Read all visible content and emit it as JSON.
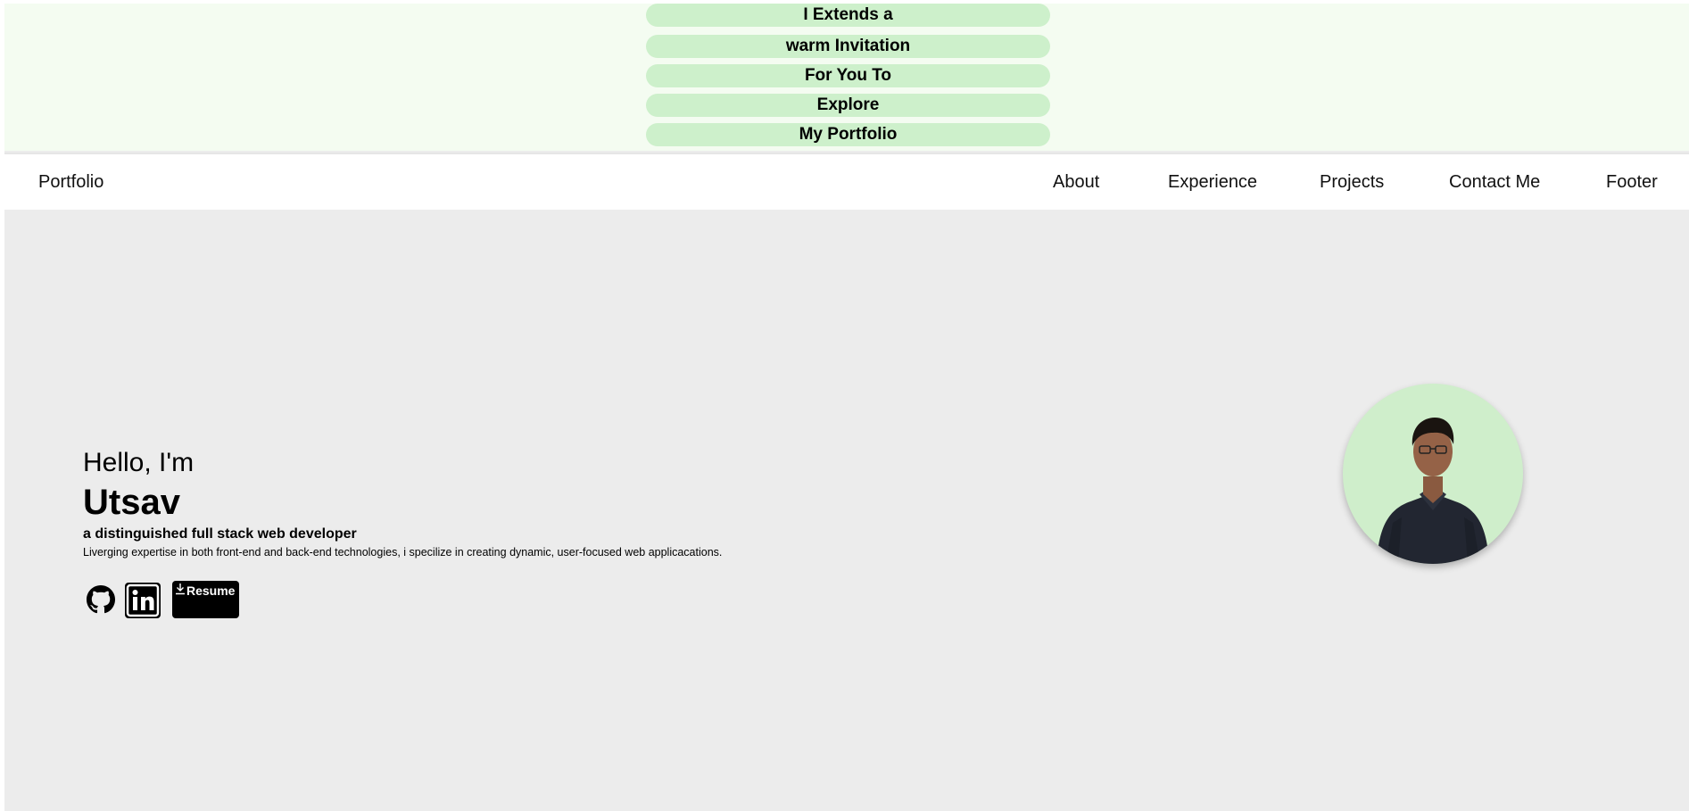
{
  "invitation": {
    "lines": [
      "I Extends a",
      "warm Invitation",
      "For You To",
      "Explore",
      "My Portfolio"
    ]
  },
  "nav": {
    "brand": "Portfolio",
    "items": [
      {
        "label": "About"
      },
      {
        "label": "Experience"
      },
      {
        "label": "Projects"
      },
      {
        "label": "Contact Me"
      },
      {
        "label": "Footer"
      }
    ]
  },
  "hero": {
    "greeting": "Hello, I'm",
    "name": "Utsav",
    "tagline": "a distinguished full stack web developer",
    "description": "Liverging expertise in both front-end and back-end technologies, i specilize in creating dynamic, user-focused web applicacations.",
    "resume_label": "Resume"
  },
  "icons": {
    "github": "github-icon",
    "linkedin": "linkedin-icon",
    "download": "download-icon"
  },
  "colors": {
    "invite_bg": "#f4fcf1",
    "pill_bg": "#cdf0cb",
    "hero_bg": "#ececec",
    "avatar_bg": "#cfeecb"
  }
}
